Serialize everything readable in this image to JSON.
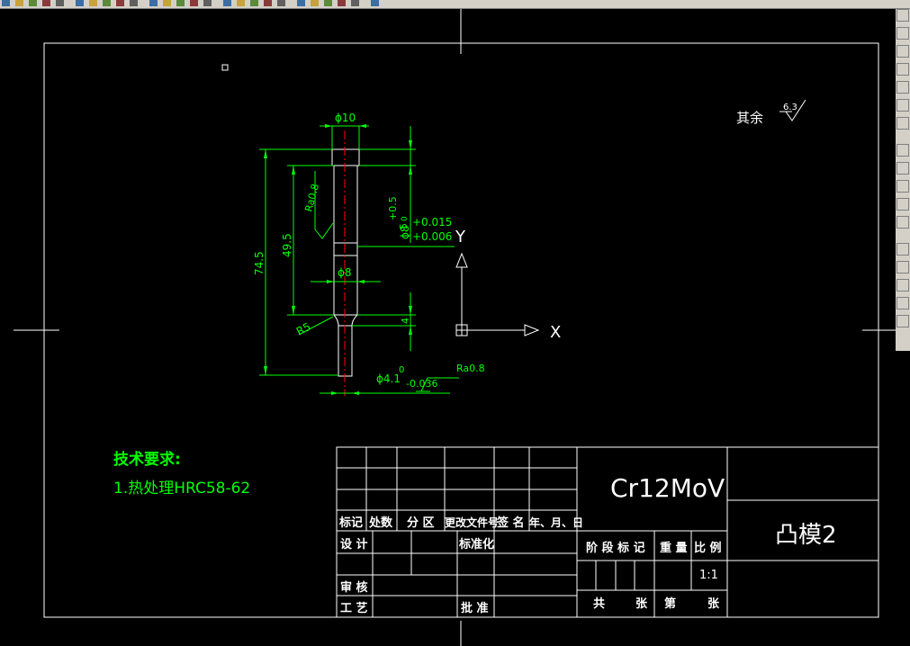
{
  "app": {
    "toolbar_icons": [
      "new-icon",
      "open-icon",
      "save-icon",
      "print-icon",
      "cut-icon",
      "copy-icon",
      "paste-icon",
      "undo-icon",
      "redo-icon",
      "pan-icon",
      "zoom-icon",
      "zoom-window-icon",
      "zoom-previous-icon",
      "properties-icon",
      "design-center-icon",
      "tool-palettes-icon",
      "sheet-set-icon",
      "markup-icon",
      "calculator-icon",
      "help-icon",
      "layer-icon",
      "layer-state-icon",
      "layer-prev-icon",
      "color-control-icon",
      "linetype-control-icon",
      "lineweight-control-icon"
    ],
    "colors": {
      "background": "#000000",
      "frame": "#ffffff",
      "dimension": "#00ff00",
      "centerline": "#ff0000",
      "part": "#ffffff",
      "tech_text": "#00ff00"
    }
  },
  "drawing": {
    "surface_note": {
      "text": "其余",
      "roughness": "6.3"
    },
    "tech_requirements": {
      "title": "技术要求:",
      "line1": "1.热处理HRC58-62"
    },
    "dimensions": {
      "d_top": "ϕ10",
      "d_mid_label": "ϕ8",
      "tol_upper_8": "+0.015",
      "tol_lower_8": "+0.006",
      "d_mid_sym": "ϕ8",
      "len_top_a": "+0.5",
      "len_top_b": "5",
      "len_top_c": "0",
      "len_total": "74.5",
      "len_body": "49.5",
      "ra_body": "Ra0.8",
      "radius": "R5",
      "len_small": "4",
      "d_small": "ϕ4.1",
      "tol_small_upper": "0",
      "tol_small_lower": "-0.036",
      "ra_small": "Ra0.8"
    },
    "ucs": {
      "x_label": "X",
      "y_label": "Y"
    }
  },
  "title_block": {
    "material": "Cr12MoV",
    "part_name": "凸模2",
    "scale": "1:1",
    "header": {
      "mark": "标记",
      "count": "处数",
      "zone": "分 区",
      "doc": "更改文件号",
      "sign": "签 名",
      "date": "年、月、日"
    },
    "design": "设 计",
    "standardize": "标准化",
    "stage_mark": "阶 段 标 记",
    "weight": "重 量",
    "ratio": "比 例",
    "review": "审 核",
    "process": "工 艺",
    "approve": "批 准",
    "total_sheets": "共",
    "sheets_unit": "张",
    "sheet_no": "第",
    "sheet_unit2": "张"
  }
}
